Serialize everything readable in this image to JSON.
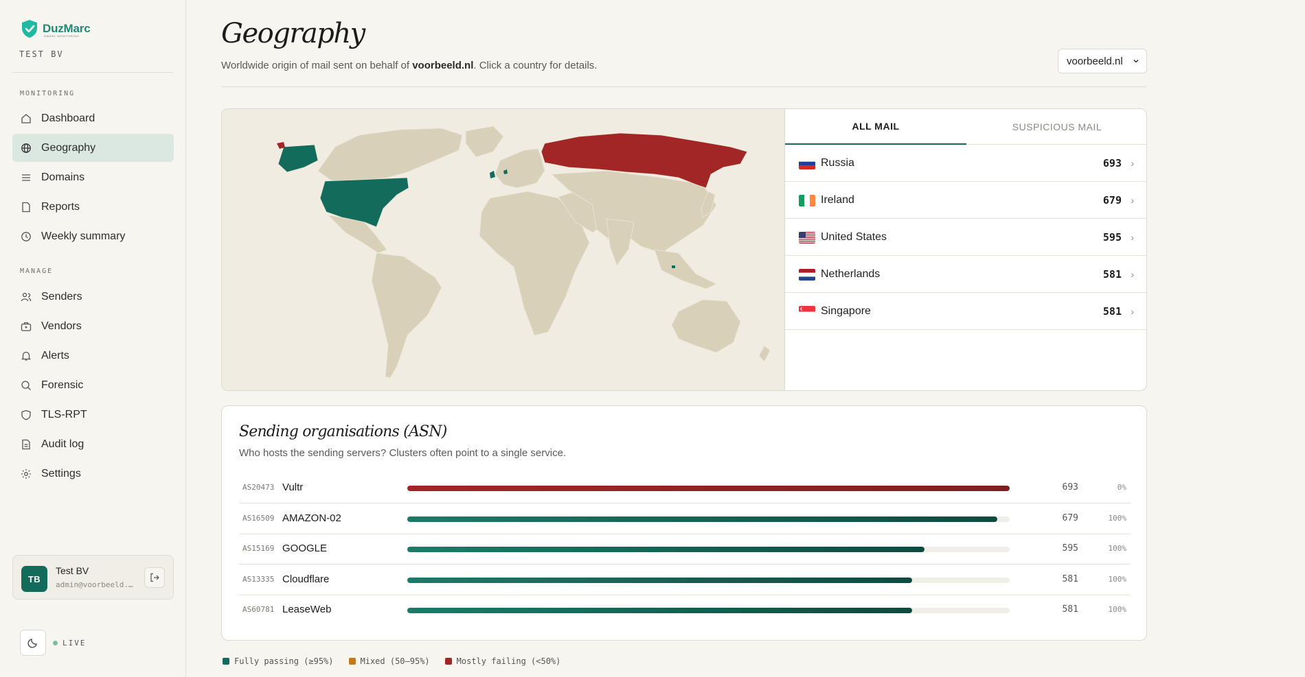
{
  "brand": {
    "name": "DuzMarc",
    "tagline": "DMARC MONITORING",
    "org": "TEST BV"
  },
  "sidebar": {
    "monitoring_label": "MONITORING",
    "manage_label": "MANAGE",
    "monitoring_items": [
      {
        "label": "Dashboard",
        "icon": "home-icon"
      },
      {
        "label": "Geography",
        "icon": "globe-icon",
        "active": true
      },
      {
        "label": "Domains",
        "icon": "list-icon"
      },
      {
        "label": "Reports",
        "icon": "file-icon"
      },
      {
        "label": "Weekly summary",
        "icon": "clock-icon"
      }
    ],
    "manage_items": [
      {
        "label": "Senders",
        "icon": "users-icon"
      },
      {
        "label": "Vendors",
        "icon": "briefcase-icon"
      },
      {
        "label": "Alerts",
        "icon": "bell-icon"
      },
      {
        "label": "Forensic",
        "icon": "search-icon"
      },
      {
        "label": "TLS-RPT",
        "icon": "shield-icon"
      },
      {
        "label": "Audit log",
        "icon": "document-icon"
      },
      {
        "label": "Settings",
        "icon": "gear-icon"
      }
    ],
    "user": {
      "initials": "TB",
      "name": "Test BV",
      "email": "admin@voorbeeld.nl"
    },
    "live_label": "LIVE"
  },
  "header": {
    "title": "Geography",
    "subtitle_pre": "Worldwide origin of mail sent on behalf of ",
    "subtitle_domain": "voorbeeld.nl",
    "subtitle_post": ". Click a country for details.",
    "domain_select": "voorbeeld.nl"
  },
  "geo": {
    "tabs": [
      {
        "label": "ALL MAIL",
        "active": true
      },
      {
        "label": "SUSPICIOUS MAIL",
        "active": false
      }
    ],
    "countries": [
      {
        "name": "Russia",
        "count": "693"
      },
      {
        "name": "Ireland",
        "count": "679"
      },
      {
        "name": "United States",
        "count": "595"
      },
      {
        "name": "Netherlands",
        "count": "581"
      },
      {
        "name": "Singapore",
        "count": "581"
      }
    ]
  },
  "asn": {
    "title": "Sending organisations (ASN)",
    "subtitle": "Who hosts the sending servers? Clusters often point to a single service.",
    "rows": [
      {
        "asn": "AS20473",
        "name": "Vultr",
        "value": 693,
        "pct": "0%",
        "status": "failing"
      },
      {
        "asn": "AS16509",
        "name": "AMAZON-02",
        "value": 679,
        "pct": "100%",
        "status": "passing"
      },
      {
        "asn": "AS15169",
        "name": "GOOGLE",
        "value": 595,
        "pct": "100%",
        "status": "passing"
      },
      {
        "asn": "AS13335",
        "name": "Cloudflare",
        "value": 581,
        "pct": "100%",
        "status": "passing"
      },
      {
        "asn": "AS60781",
        "name": "LeaseWeb",
        "value": 581,
        "pct": "100%",
        "status": "passing"
      }
    ],
    "max_value": 693
  },
  "legend": [
    {
      "label": "Fully passing (≥95%)",
      "color": "#136b5c"
    },
    {
      "label": "Mixed (50–95%)",
      "color": "#c47a1a"
    },
    {
      "label": "Mostly failing (<50%)",
      "color": "#a32626"
    }
  ],
  "colors": {
    "accent": "#136b5c",
    "failing": "#a32626",
    "map_land": "#d8d0b8",
    "map_bg": "#f0ece2"
  }
}
